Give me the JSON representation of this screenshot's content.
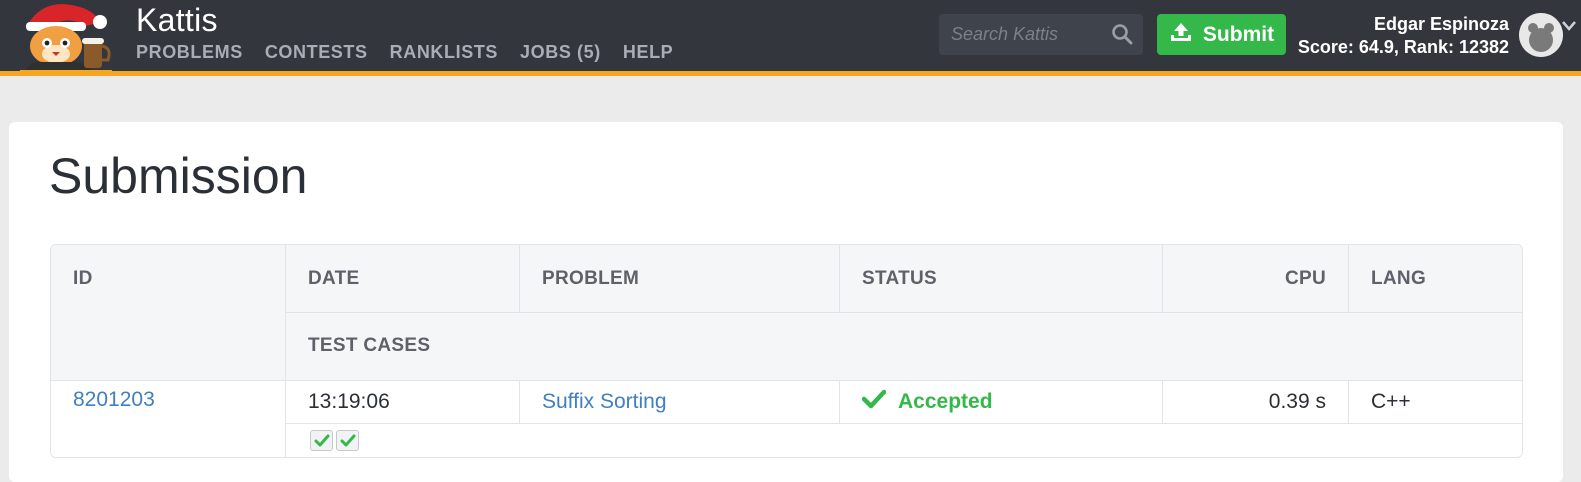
{
  "header": {
    "brand": "Kattis",
    "nav": [
      "PROBLEMS",
      "CONTESTS",
      "RANKLISTS",
      "JOBS (5)",
      "HELP"
    ],
    "search_placeholder": "Search Kattis",
    "submit_label": "Submit",
    "user_name": "Edgar Espinoza",
    "user_stats": "Score: 64.9, Rank: 12382"
  },
  "page": {
    "title": "Submission"
  },
  "table": {
    "columns": {
      "id": "ID",
      "date": "DATE",
      "problem": "PROBLEM",
      "status": "STATUS",
      "cpu": "CPU",
      "lang": "LANG",
      "test_cases": "TEST CASES"
    },
    "row": {
      "id": "8201203",
      "date": "13:19:06",
      "problem": "Suffix Sorting",
      "status": "Accepted",
      "cpu": "0.39 s",
      "lang": "C++",
      "test_cases_passed": 2,
      "test_cases_total": 2
    }
  },
  "colors": {
    "nav_bg": "#33363d",
    "accent_orange": "#f5a623",
    "accept_green": "#34b84a",
    "link_blue": "#3f7fc2"
  },
  "icons": [
    "kattis-cat-logo",
    "search-icon",
    "upload-icon",
    "avatar-icon",
    "caret-down-icon",
    "checkmark-icon"
  ]
}
